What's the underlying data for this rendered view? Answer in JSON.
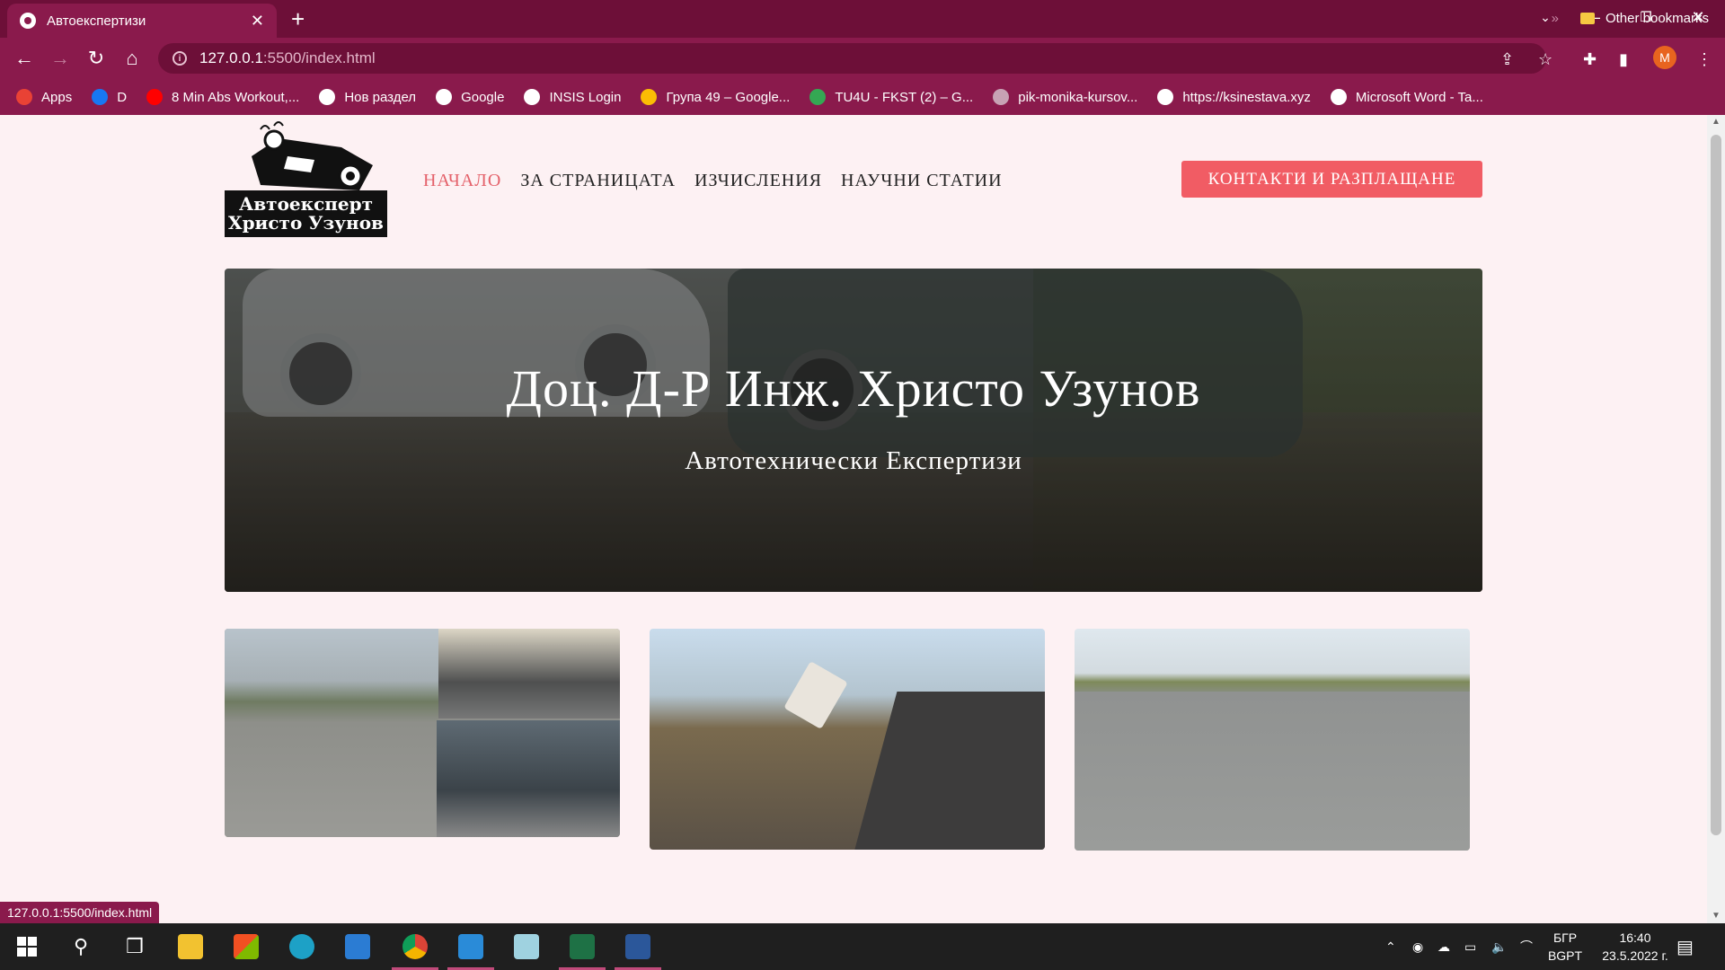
{
  "browser": {
    "tab_title": "Автоекспертизи",
    "tab_close": "✕",
    "new_tab": "+",
    "url_host": "127.0.0.1",
    "url_path": ":5500/index.html",
    "avatar_letter": "M",
    "status_url": "127.0.0.1:5500/index.html"
  },
  "bookmarks": [
    {
      "label": "Apps",
      "icon": "apps-grid-icon",
      "color": "#e94235"
    },
    {
      "label": "D",
      "icon": "facebook-icon",
      "color": "#1877f2"
    },
    {
      "label": "8 Min Abs Workout,...",
      "icon": "youtube-icon",
      "color": "#ff0000"
    },
    {
      "label": "Нов раздел",
      "icon": "globe-icon",
      "color": "#ffffff"
    },
    {
      "label": "Google",
      "icon": "google-icon",
      "color": "#ffffff"
    },
    {
      "label": "INSIS Login",
      "icon": "globe-icon",
      "color": "#ffffff"
    },
    {
      "label": "Група 49 – Google...",
      "icon": "drive-icon",
      "color": "#fbbc04"
    },
    {
      "label": "TU4U - FKST (2) – G...",
      "icon": "drive-icon",
      "color": "#34a853"
    },
    {
      "label": "pik-monika-kursov...",
      "icon": "file-icon",
      "color": "#c7a2b4"
    },
    {
      "label": "https://ksinestava.xyz",
      "icon": "globe-icon",
      "color": "#ffffff"
    },
    {
      "label": "Microsoft Word - Ta...",
      "icon": "globe-icon",
      "color": "#ffffff"
    }
  ],
  "other_bookmarks": "Other bookmarks",
  "more_bookmarks": "»",
  "site": {
    "logo_line1": "Автоексперт",
    "logo_line2": "Христо Узунов",
    "nav": [
      {
        "label": "НАЧАЛО",
        "active": true
      },
      {
        "label": "ЗА СТРАНИЦАТА",
        "active": false
      },
      {
        "label": "ИЗЧИСЛЕНИЯ",
        "active": false
      },
      {
        "label": "НАУЧНИ СТАТИИ",
        "active": false
      }
    ],
    "cta": "КОНТАКТИ И РАЗПЛАЩАНЕ",
    "hero_title": "Доц. Д-Р Инж. Христо Узунов",
    "hero_subtitle": "Автотехнически Експертизи",
    "accent_color": "#f15c64"
  },
  "taskbar": {
    "lang_top": "БГР",
    "lang_bottom": "BGPT",
    "time": "16:40",
    "date": "23.5.2022 г."
  }
}
